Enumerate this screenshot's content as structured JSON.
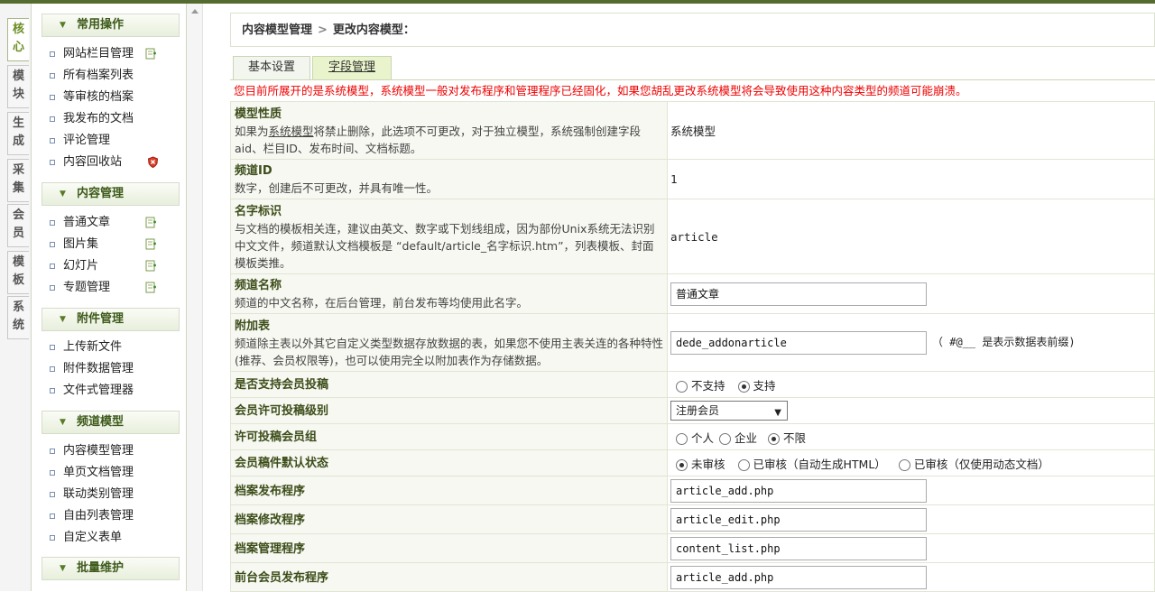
{
  "vtabs": [
    "核心",
    "模块",
    "生成",
    "采集",
    "会员",
    "模板",
    "系统"
  ],
  "sidebar": {
    "groups": [
      {
        "title": "常用操作",
        "items": [
          "网站栏目管理",
          "所有档案列表",
          "等审核的档案",
          "我发布的文档",
          "评论管理",
          "内容回收站"
        ]
      },
      {
        "title": "内容管理",
        "items": [
          "普通文章",
          "图片集",
          "幻灯片",
          "专题管理"
        ]
      },
      {
        "title": "附件管理",
        "items": [
          "上传新文件",
          "附件数据管理",
          "文件式管理器"
        ]
      },
      {
        "title": "频道模型",
        "items": [
          "内容模型管理",
          "单页文档管理",
          "联动类别管理",
          "自由列表管理",
          "自定义表单"
        ]
      },
      {
        "title": "批量维护",
        "items": []
      }
    ]
  },
  "breadcrumb": {
    "part1": "内容模型管理",
    "sep": ">",
    "part2": "更改内容模型："
  },
  "tabs": {
    "basic": "基本设置",
    "fields": "字段管理"
  },
  "warning": "您目前所展开的是系统模型，系统模型一般对发布程序和管理程序已经固化，如果您胡乱更改系统模型将会导致使用这种内容类型的频道可能崩溃。",
  "form": {
    "model_nature": {
      "label": "模型性质",
      "desc_pre": "如果为",
      "desc_link": "系统模型",
      "desc_post": "将禁止删除，此选项不可更改，对于独立模型，系统强制创建字段aid、栏目ID、发布时间、文档标题。",
      "value": "系统模型"
    },
    "channel_id": {
      "label": "频道ID",
      "desc": "数字，创建后不可更改，并具有唯一性。",
      "value": "1"
    },
    "name_id": {
      "label": "名字标识",
      "desc": "与文档的模板相关连，建议由英文、数字或下划线组成，因为部份Unix系统无法识别中文文件，频道默认文档模板是 “default/article_名字标识.htm”，列表模板、封面模板类推。",
      "value": "article"
    },
    "channel_name": {
      "label": "频道名称",
      "desc": "频道的中文名称，在后台管理，前台发布等均使用此名字。",
      "value": "普通文章"
    },
    "addon_table": {
      "label": "附加表",
      "desc": "频道除主表以外其它自定义类型数据存放数据的表，如果您不使用主表关连的各种特性(推荐、会员权限等)，也可以使用完全以附加表作为存储数据。",
      "value": "dede_addonarticle",
      "note": "（ #@__ 是表示数据表前缀)"
    },
    "member_submit": {
      "label": "是否支持会员投稿",
      "opt1": "不支持",
      "opt2": "支持"
    },
    "member_level": {
      "label": "会员许可投稿级别",
      "value": "注册会员"
    },
    "member_group": {
      "label": "许可投稿会员组",
      "opt1": "个人",
      "opt2": "企业",
      "opt3": "不限"
    },
    "default_status": {
      "label": "会员稿件默认状态",
      "opt1": "未审核",
      "opt2": "已审核（自动生成HTML）",
      "opt3": "已审核（仅使用动态文档）"
    },
    "add_prog": {
      "label": "档案发布程序",
      "value": "article_add.php"
    },
    "edit_prog": {
      "label": "档案修改程序",
      "value": "article_edit.php"
    },
    "list_prog": {
      "label": "档案管理程序",
      "value": "content_list.php"
    },
    "front_add_prog": {
      "label": "前台会员发布程序",
      "value": "article_add.php"
    }
  },
  "colors": {
    "accent": "#556b2f",
    "warning": "#ee0000"
  }
}
